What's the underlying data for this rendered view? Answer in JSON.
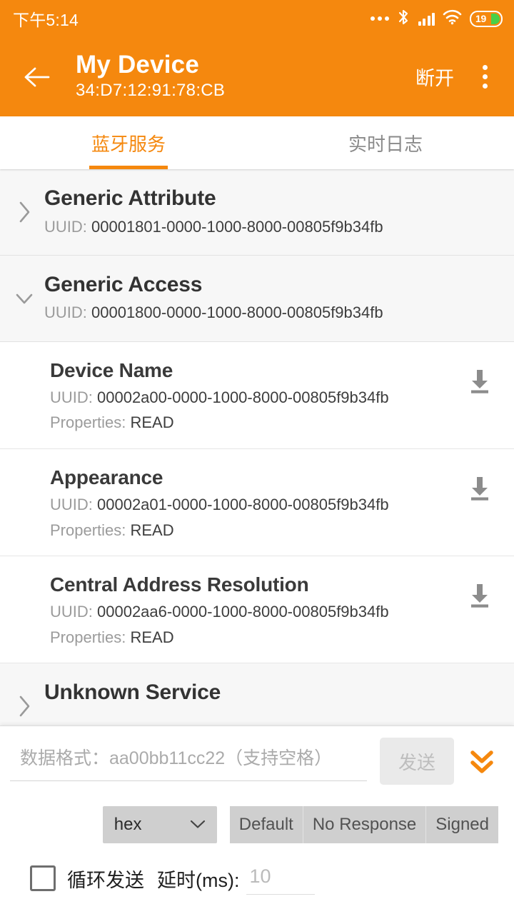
{
  "status_bar": {
    "time": "下午5:14",
    "battery_level": "19",
    "icons": [
      "more-dots-icon",
      "bluetooth-icon",
      "signal-icon",
      "wifi-icon",
      "battery-icon"
    ]
  },
  "app_bar": {
    "back_icon": "arrow-left-icon",
    "title": "My Device",
    "mac_address": "34:D7:12:91:78:CB",
    "disconnect_label": "断开",
    "overflow_icon": "more-vertical-icon",
    "accent_color": "#F5880E"
  },
  "tabs": [
    {
      "label": "蓝牙服务",
      "active": true
    },
    {
      "label": "实时日志",
      "active": false
    }
  ],
  "list": {
    "uuid_prefix": "UUID: ",
    "properties_prefix": "Properties: ",
    "services": [
      {
        "name": "Generic Attribute",
        "uuid": "00001801-0000-1000-8000-00805f9b34fb",
        "expanded": false,
        "chevron": "chevron-right-icon",
        "characteristics": []
      },
      {
        "name": "Generic Access",
        "uuid": "00001800-0000-1000-8000-00805f9b34fb",
        "expanded": true,
        "chevron": "chevron-down-icon",
        "characteristics": [
          {
            "name": "Device Name",
            "uuid": "00002a00-0000-1000-8000-00805f9b34fb",
            "properties": "READ",
            "action_icon": "download-icon"
          },
          {
            "name": "Appearance",
            "uuid": "00002a01-0000-1000-8000-00805f9b34fb",
            "properties": "READ",
            "action_icon": "download-icon"
          },
          {
            "name": "Central Address Resolution",
            "uuid": "00002aa6-0000-1000-8000-00805f9b34fb",
            "properties": "READ",
            "action_icon": "download-icon"
          }
        ]
      },
      {
        "name": "Unknown Service",
        "uuid": "",
        "expanded": false,
        "chevron": "chevron-right-icon",
        "characteristics": []
      }
    ]
  },
  "bottom_panel": {
    "data_input_placeholder": "数据格式：aa00bb11cc22（支持空格）",
    "data_input_value": "",
    "send_label": "发送",
    "send_enabled": false,
    "expand_icon": "chevrons-down-icon",
    "expand_icon_color": "#F5880E",
    "format_value": "hex",
    "format_chevron": "chevron-down-icon",
    "write_types": [
      "Default",
      "No Response",
      "Signed"
    ],
    "loop_checkbox_checked": false,
    "loop_label": "循环发送",
    "delay_label": "延时(ms):",
    "delay_placeholder": "10",
    "delay_value": ""
  }
}
